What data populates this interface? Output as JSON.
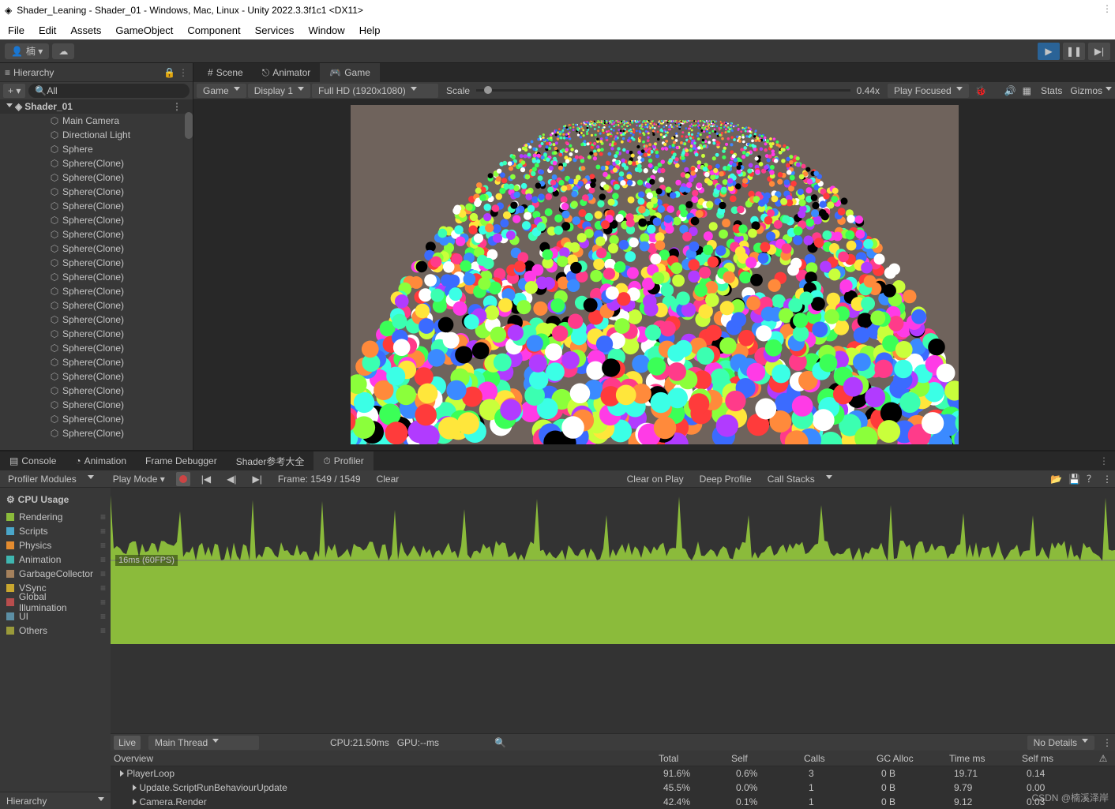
{
  "window": {
    "title": "Shader_Leaning - Shader_01 - Windows, Mac, Linux - Unity 2022.3.3f1c1 <DX11>"
  },
  "menu": [
    "File",
    "Edit",
    "Assets",
    "GameObject",
    "Component",
    "Services",
    "Window",
    "Help"
  ],
  "account": {
    "name": "楠 ▾"
  },
  "hierarchy": {
    "title": "Hierarchy",
    "search_placeholder": "All",
    "root": "Shader_01",
    "children": [
      "Main Camera",
      "Directional Light",
      "Sphere",
      "Sphere(Clone)",
      "Sphere(Clone)",
      "Sphere(Clone)",
      "Sphere(Clone)",
      "Sphere(Clone)",
      "Sphere(Clone)",
      "Sphere(Clone)",
      "Sphere(Clone)",
      "Sphere(Clone)",
      "Sphere(Clone)",
      "Sphere(Clone)",
      "Sphere(Clone)",
      "Sphere(Clone)",
      "Sphere(Clone)",
      "Sphere(Clone)",
      "Sphere(Clone)",
      "Sphere(Clone)",
      "Sphere(Clone)",
      "Sphere(Clone)",
      "Sphere(Clone)"
    ]
  },
  "game": {
    "tabs": [
      {
        "label": "Scene",
        "icon": "#"
      },
      {
        "label": "Animator",
        "icon": "⚙"
      },
      {
        "label": "Game",
        "icon": "🎮"
      }
    ],
    "dropdown_game": "Game",
    "display": "Display 1",
    "resolution": "Full HD (1920x1080)",
    "scale_label": "Scale",
    "scale_value": "0.44x",
    "play_mode": "Play Focused",
    "buttons": [
      "Stats",
      "Gizmos"
    ]
  },
  "bottom_tabs": [
    "Console",
    "Animation",
    "Frame Debugger",
    "Shader参考大全",
    "Profiler"
  ],
  "profiler": {
    "modules_label": "Profiler Modules",
    "play_mode": "Play Mode ▾",
    "frame": "Frame: 1549 / 1549",
    "clear": "Clear",
    "clear_on_play": "Clear on Play",
    "deep": "Deep Profile",
    "call_stacks": "Call Stacks",
    "cpu_title": "CPU Usage",
    "fps_line": "16ms (60FPS)",
    "categories": [
      {
        "name": "Rendering",
        "color": "#8bbb3b"
      },
      {
        "name": "Scripts",
        "color": "#4aa6c9"
      },
      {
        "name": "Physics",
        "color": "#e38b2f"
      },
      {
        "name": "Animation",
        "color": "#3fb6b0"
      },
      {
        "name": "GarbageCollector",
        "color": "#a5815c"
      },
      {
        "name": "VSync",
        "color": "#c9a72f"
      },
      {
        "name": "Global Illumination",
        "color": "#b84d4d"
      },
      {
        "name": "UI",
        "color": "#5c8fa5"
      },
      {
        "name": "Others",
        "color": "#9a9a3a"
      }
    ],
    "hierarchy_label": "Hierarchy",
    "live": "Live",
    "thread": "Main Thread",
    "cpu_time": "CPU:21.50ms",
    "gpu_time": "GPU:--ms",
    "details": "No Details",
    "columns": [
      "Overview",
      "Total",
      "Self",
      "Calls",
      "GC Alloc",
      "Time ms",
      "Self ms"
    ],
    "rows": [
      {
        "name": "PlayerLoop",
        "indent": 0,
        "total": "91.6%",
        "self": "0.6%",
        "calls": "3",
        "gc": "0 B",
        "time": "19.71",
        "selfms": "0.14"
      },
      {
        "name": "Update.ScriptRunBehaviourUpdate",
        "indent": 1,
        "total": "45.5%",
        "self": "0.0%",
        "calls": "1",
        "gc": "0 B",
        "time": "9.79",
        "selfms": "0.00"
      },
      {
        "name": "Camera.Render",
        "indent": 1,
        "total": "42.4%",
        "self": "0.1%",
        "calls": "1",
        "gc": "0 B",
        "time": "9.12",
        "selfms": "0.03"
      }
    ]
  },
  "watermark": "CSDN @楠溪泽岸"
}
